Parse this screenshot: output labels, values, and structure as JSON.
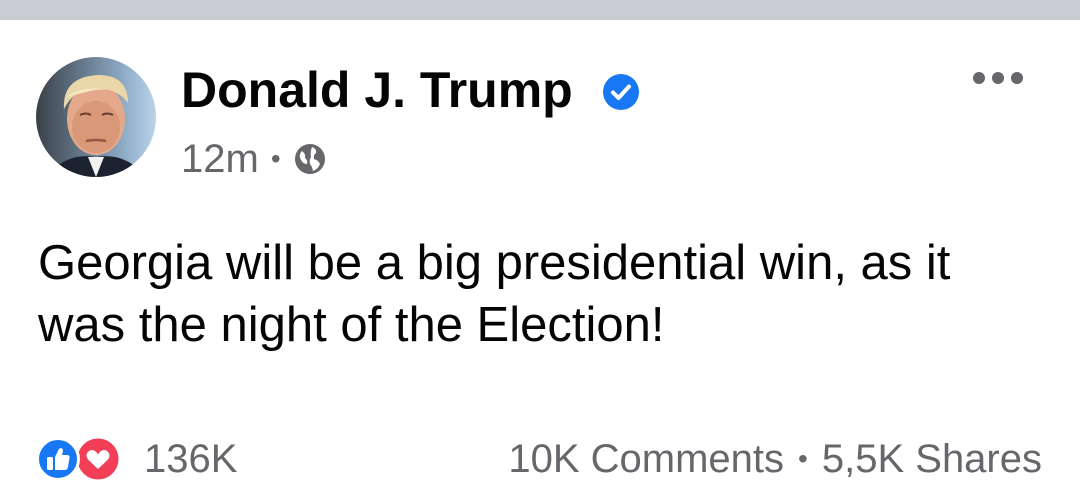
{
  "post": {
    "author": "Donald J. Trump",
    "time": "12m",
    "separator": "•",
    "text": "Georgia will be a big presidential win, as it was the night of the Election!",
    "icons": {
      "verified": "verified-badge-icon",
      "privacy": "globe-icon",
      "more": "more-options-icon"
    }
  },
  "footer": {
    "reactions_count": "136K",
    "comments": "10K Comments",
    "separator": "•",
    "shares": "5,5K Shares",
    "icons": [
      "like-reaction-icon",
      "love-reaction-icon"
    ]
  },
  "colors": {
    "facebook_blue": "#1877f2",
    "love_red": "#f33e58",
    "secondary_text": "#65676b",
    "divider": "#c9ccd1"
  }
}
